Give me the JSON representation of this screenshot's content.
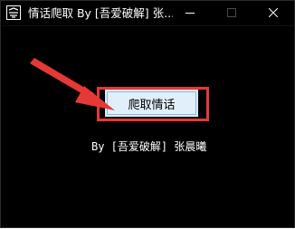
{
  "window": {
    "title": "情话爬取 By [吾爱破解] 张...",
    "controls": {
      "minimize": "minimize",
      "maximize": "maximize",
      "close": "close"
    }
  },
  "main": {
    "button_label": "爬取情话",
    "credit": "By [吾爱破解] 张晨曦"
  },
  "icons": {
    "app": "app-logo-icon",
    "minimize": "minimize-icon",
    "maximize": "maximize-icon",
    "close": "close-icon",
    "annotation": "red-arrow-icon"
  },
  "colors": {
    "window_bg": "#000000",
    "text": "#ffffff",
    "button_bg": "#e1effa",
    "annotation": "#e53935"
  }
}
